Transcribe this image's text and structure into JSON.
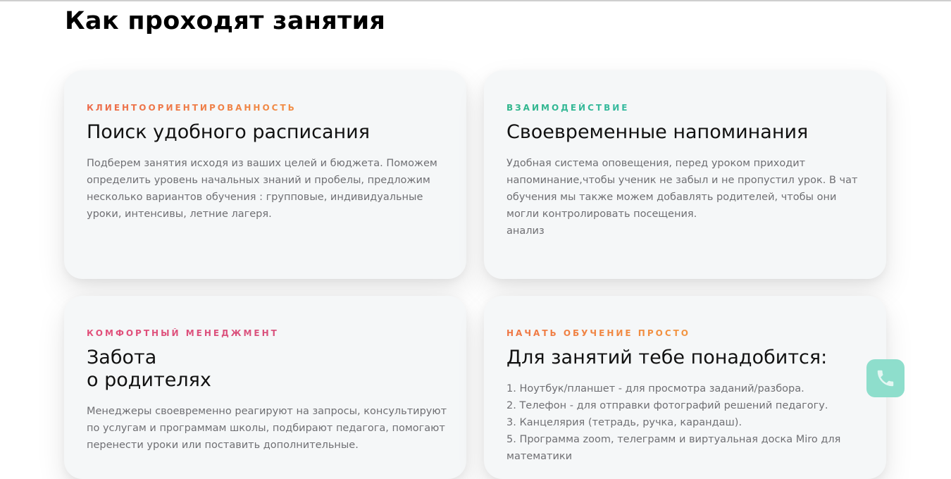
{
  "section": {
    "title": "Как проходят занятия"
  },
  "cards": [
    {
      "tag": "клиентоориентированность",
      "title": "Поиск удобного расписания",
      "lines": [
        "Подберем занятия исходя из ваших целей и бюджета. Поможем",
        "определить уровень начальных знаний и пробелы, предложим",
        "несколько вариантов обучения : групповые, индивидуальные",
        "уроки, интенсивы, летние лагеря."
      ]
    },
    {
      "tag": "взаимодействие",
      "title": "Своевременные напоминания",
      "lines": [
        "Удобная система оповещения, перед уроком приходит",
        "напоминание,чтобы ученик не забыл и не пропустил урок. В чат",
        "обучения  мы также можем добавлять родителей, чтобы они",
        "могли контролировать посещения.",
        "анализ"
      ]
    },
    {
      "tag": "комфортный менеджмент",
      "title_lines": [
        "Забота",
        "о родителях"
      ],
      "lines": [
        "Менеджеры своевременно реагируют на запросы, консультируют",
        "по услугам и программам школы, подбирают педагога, помогают",
        "перенести уроки или поставить дополнительные."
      ]
    },
    {
      "tag": "начать обучение просто",
      "title": "Для занятий тебе понадобится:",
      "lines": [
        "1. Ноутбук/планшет - для просмотра заданий/разбора.",
        "2. Телефон - для отправки фотографий решений педагогу.",
        "3. Канцелярия (тетрадь, ручка, карандаш).",
        "5. Программа  zoom,  телеграмм и  виртуальная доска Miro для",
        "математики"
      ]
    }
  ],
  "widgets": {
    "phone_icon": "phone-icon",
    "phone_color": "#8edecc"
  }
}
